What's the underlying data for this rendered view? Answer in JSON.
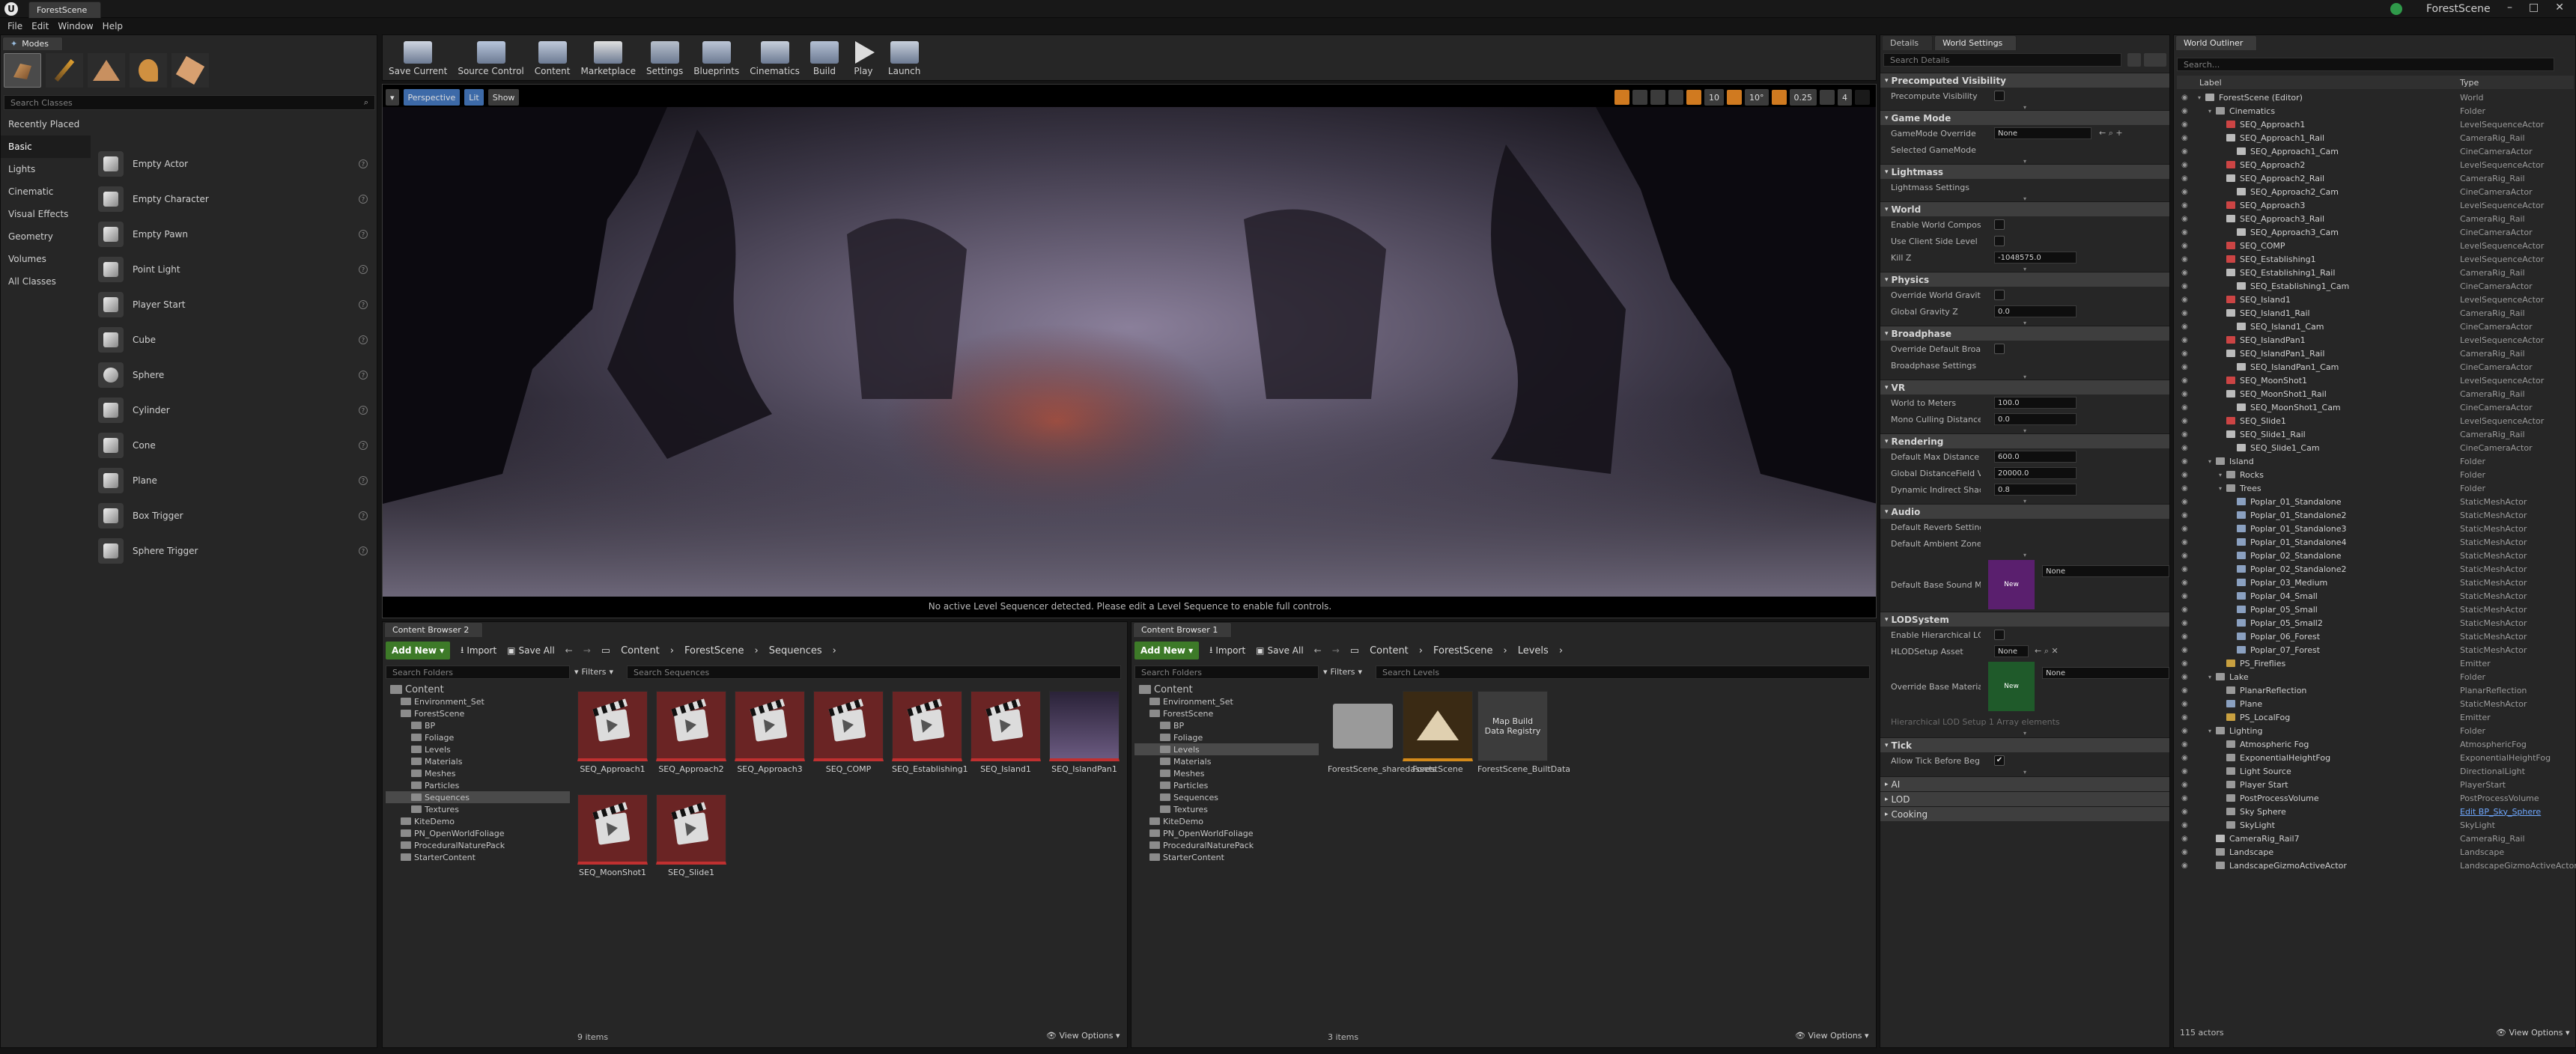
{
  "window": {
    "doc_tab": "ForestScene",
    "project_name": "ForestScene"
  },
  "menu": [
    "File",
    "Edit",
    "Window",
    "Help"
  ],
  "modes": {
    "tab": "Modes",
    "search_placeholder": "Search Classes",
    "categories": [
      "Recently Placed",
      "Basic",
      "Lights",
      "Cinematic",
      "Visual Effects",
      "Geometry",
      "Volumes",
      "All Classes"
    ],
    "items": [
      "Empty Actor",
      "Empty Character",
      "Empty Pawn",
      "Point Light",
      "Player Start",
      "Cube",
      "Sphere",
      "Cylinder",
      "Cone",
      "Plane",
      "Box Trigger",
      "Sphere Trigger"
    ]
  },
  "toolbar": {
    "buttons": [
      "Save Current",
      "Source Control",
      "Content",
      "Marketplace",
      "Settings",
      "Blueprints",
      "Cinematics",
      "Build",
      "Play",
      "Launch"
    ]
  },
  "viewport": {
    "perspective": "Perspective",
    "lit": "Lit",
    "show": "Show",
    "grid_snap": "10",
    "rot_snap": "10°",
    "scale_snap": "0.25",
    "cam_speed": "4",
    "message": "No active Level Sequencer detected. Please edit a Level Sequence to enable full controls."
  },
  "content_browser_2": {
    "tab": "Content Browser 2",
    "add_new": "Add New",
    "import": "Import",
    "save_all": "Save All",
    "breadcrumb": [
      "Content",
      "ForestScene",
      "Sequences"
    ],
    "search_folders": "Search Folders",
    "filters": "Filters",
    "search_assets": "Search Sequences",
    "tree": [
      {
        "label": "Content",
        "depth": 0
      },
      {
        "label": "Environment_Set",
        "depth": 1
      },
      {
        "label": "ForestScene",
        "depth": 1
      },
      {
        "label": "BP",
        "depth": 2
      },
      {
        "label": "Foliage",
        "depth": 2
      },
      {
        "label": "Levels",
        "depth": 2
      },
      {
        "label": "Materials",
        "depth": 2
      },
      {
        "label": "Meshes",
        "depth": 2
      },
      {
        "label": "Particles",
        "depth": 2
      },
      {
        "label": "Sequences",
        "depth": 2
      },
      {
        "label": "Textures",
        "depth": 2
      },
      {
        "label": "KiteDemo",
        "depth": 1
      },
      {
        "label": "PN_OpenWorldFoliage",
        "depth": 1
      },
      {
        "label": "ProceduralNaturePack",
        "depth": 1
      },
      {
        "label": "StarterContent",
        "depth": 1
      }
    ],
    "assets": [
      "SEQ_Approach1",
      "SEQ_Approach2",
      "SEQ_Approach3",
      "SEQ_COMP",
      "SEQ_Establishing1",
      "SEQ_Island1",
      "SEQ_IslandPan1",
      "SEQ_MoonShot1",
      "SEQ_Slide1"
    ],
    "count": "9 items",
    "view_options": "View Options"
  },
  "content_browser_1": {
    "tab": "Content Browser 1",
    "add_new": "Add New",
    "import": "Import",
    "save_all": "Save All",
    "breadcrumb": [
      "Content",
      "ForestScene",
      "Levels"
    ],
    "search_folders": "Search Folders",
    "filters": "Filters",
    "search_assets": "Search Levels",
    "assets": [
      "ForestScene_sharedassets",
      "ForestScene",
      "ForestScene_BuiltData"
    ],
    "map_build_label": "Map Build Data Registry",
    "count": "3 items",
    "view_options": "View Options"
  },
  "details": {
    "tab": "Details",
    "tab2": "World Settings",
    "search_placeholder": "Search Details",
    "sections": [
      {
        "title": "Precomputed Visibility",
        "rows": [
          {
            "label": "Precompute Visibility",
            "type": "check",
            "value": ""
          }
        ]
      },
      {
        "title": "Game Mode",
        "rows": [
          {
            "label": "GameMode Override",
            "type": "combo",
            "value": "None"
          },
          {
            "label": "Selected GameMode",
            "type": "none",
            "value": ""
          }
        ]
      },
      {
        "title": "Lightmass",
        "rows": [
          {
            "label": "Lightmass Settings",
            "type": "none",
            "value": ""
          }
        ]
      },
      {
        "title": "World",
        "rows": [
          {
            "label": "Enable World Composi",
            "type": "check",
            "value": ""
          },
          {
            "label": "Use Client Side Level S",
            "type": "check",
            "value": ""
          },
          {
            "label": "Kill Z",
            "type": "num",
            "value": "-1048575.0"
          }
        ]
      },
      {
        "title": "Physics",
        "rows": [
          {
            "label": "Override World Gravity",
            "type": "check",
            "value": ""
          },
          {
            "label": "Global Gravity Z",
            "type": "num",
            "value": "0.0"
          }
        ]
      },
      {
        "title": "Broadphase",
        "rows": [
          {
            "label": "Override Default Broa",
            "type": "check",
            "value": ""
          },
          {
            "label": "Broadphase Settings",
            "type": "none",
            "value": ""
          }
        ]
      },
      {
        "title": "VR",
        "rows": [
          {
            "label": "World to Meters",
            "type": "num",
            "value": "100.0"
          },
          {
            "label": "Mono Culling Distance",
            "type": "num",
            "value": "0.0"
          }
        ]
      },
      {
        "title": "Rendering",
        "rows": [
          {
            "label": "Default Max Distance",
            "type": "num",
            "value": "600.0"
          },
          {
            "label": "Global DistanceField V",
            "type": "num",
            "value": "20000.0"
          },
          {
            "label": "Dynamic Indirect Shad",
            "type": "num",
            "value": "0.8"
          }
        ]
      },
      {
        "title": "Audio",
        "rows": [
          {
            "label": "Default Reverb Setting",
            "type": "none",
            "value": ""
          },
          {
            "label": "Default Ambient Zone",
            "type": "none",
            "value": ""
          }
        ]
      }
    ],
    "sound_mix_label": "Default Base Sound M",
    "sound_mix_value": "None",
    "thumb_new": "New",
    "lod_title": "LODSystem",
    "lod_rows": [
      "Enable Hierarchical LC",
      "HLODSetup Asset",
      "Override Base Materia"
    ],
    "hlod_value": "None",
    "override_mat_value": "None",
    "hlod_elements": "Hierarchical LOD Setup  1 Array elements",
    "tick_title": "Tick",
    "tick_row": "Allow Tick Before Begi",
    "collapsed": [
      "AI",
      "LOD",
      "Cooking"
    ]
  },
  "outliner": {
    "tab": "World Outliner",
    "search_placeholder": "Search...",
    "col_label": "Label",
    "col_type": "Type",
    "rows": [
      {
        "l": "ForestScene (Editor)",
        "t": "World",
        "d": 0
      },
      {
        "l": "Cinematics",
        "t": "Folder",
        "d": 1
      },
      {
        "l": "SEQ_Approach1",
        "t": "LevelSequenceActor",
        "d": 2
      },
      {
        "l": "SEQ_Approach1_Rail",
        "t": "CameraRig_Rail",
        "d": 2
      },
      {
        "l": "SEQ_Approach1_Cam",
        "t": "CineCameraActor",
        "d": 3
      },
      {
        "l": "SEQ_Approach2",
        "t": "LevelSequenceActor",
        "d": 2
      },
      {
        "l": "SEQ_Approach2_Rail",
        "t": "CameraRig_Rail",
        "d": 2
      },
      {
        "l": "SEQ_Approach2_Cam",
        "t": "CineCameraActor",
        "d": 3
      },
      {
        "l": "SEQ_Approach3",
        "t": "LevelSequenceActor",
        "d": 2
      },
      {
        "l": "SEQ_Approach3_Rail",
        "t": "CameraRig_Rail",
        "d": 2
      },
      {
        "l": "SEQ_Approach3_Cam",
        "t": "CineCameraActor",
        "d": 3
      },
      {
        "l": "SEQ_COMP",
        "t": "LevelSequenceActor",
        "d": 2
      },
      {
        "l": "SEQ_Establishing1",
        "t": "LevelSequenceActor",
        "d": 2
      },
      {
        "l": "SEQ_Establishing1_Rail",
        "t": "CameraRig_Rail",
        "d": 2
      },
      {
        "l": "SEQ_Establishing1_Cam",
        "t": "CineCameraActor",
        "d": 3
      },
      {
        "l": "SEQ_Island1",
        "t": "LevelSequenceActor",
        "d": 2
      },
      {
        "l": "SEQ_Island1_Rail",
        "t": "CameraRig_Rail",
        "d": 2
      },
      {
        "l": "SEQ_Island1_Cam",
        "t": "CineCameraActor",
        "d": 3
      },
      {
        "l": "SEQ_IslandPan1",
        "t": "LevelSequenceActor",
        "d": 2
      },
      {
        "l": "SEQ_IslandPan1_Rail",
        "t": "CameraRig_Rail",
        "d": 2
      },
      {
        "l": "SEQ_IslandPan1_Cam",
        "t": "CineCameraActor",
        "d": 3
      },
      {
        "l": "SEQ_MoonShot1",
        "t": "LevelSequenceActor",
        "d": 2
      },
      {
        "l": "SEQ_MoonShot1_Rail",
        "t": "CameraRig_Rail",
        "d": 2
      },
      {
        "l": "SEQ_MoonShot1_Cam",
        "t": "CineCameraActor",
        "d": 3
      },
      {
        "l": "SEQ_Slide1",
        "t": "LevelSequenceActor",
        "d": 2
      },
      {
        "l": "SEQ_Slide1_Rail",
        "t": "CameraRig_Rail",
        "d": 2
      },
      {
        "l": "SEQ_Slide1_Cam",
        "t": "CineCameraActor",
        "d": 3
      },
      {
        "l": "Island",
        "t": "Folder",
        "d": 1
      },
      {
        "l": "Rocks",
        "t": "Folder",
        "d": 2
      },
      {
        "l": "Trees",
        "t": "Folder",
        "d": 2
      },
      {
        "l": "Poplar_01_Standalone",
        "t": "StaticMeshActor",
        "d": 3
      },
      {
        "l": "Poplar_01_Standalone2",
        "t": "StaticMeshActor",
        "d": 3
      },
      {
        "l": "Poplar_01_Standalone3",
        "t": "StaticMeshActor",
        "d": 3
      },
      {
        "l": "Poplar_01_Standalone4",
        "t": "StaticMeshActor",
        "d": 3
      },
      {
        "l": "Poplar_02_Standalone",
        "t": "StaticMeshActor",
        "d": 3
      },
      {
        "l": "Poplar_02_Standalone2",
        "t": "StaticMeshActor",
        "d": 3
      },
      {
        "l": "Poplar_03_Medium",
        "t": "StaticMeshActor",
        "d": 3
      },
      {
        "l": "Poplar_04_Small",
        "t": "StaticMeshActor",
        "d": 3
      },
      {
        "l": "Poplar_05_Small",
        "t": "StaticMeshActor",
        "d": 3
      },
      {
        "l": "Poplar_05_Small2",
        "t": "StaticMeshActor",
        "d": 3
      },
      {
        "l": "Poplar_06_Forest",
        "t": "StaticMeshActor",
        "d": 3
      },
      {
        "l": "Poplar_07_Forest",
        "t": "StaticMeshActor",
        "d": 3
      },
      {
        "l": "PS_Fireflies",
        "t": "Emitter",
        "d": 2
      },
      {
        "l": "Lake",
        "t": "Folder",
        "d": 1
      },
      {
        "l": "PlanarReflection",
        "t": "PlanarReflection",
        "d": 2
      },
      {
        "l": "Plane",
        "t": "StaticMeshActor",
        "d": 2
      },
      {
        "l": "PS_LocalFog",
        "t": "Emitter",
        "d": 2
      },
      {
        "l": "Lighting",
        "t": "Folder",
        "d": 1
      },
      {
        "l": "Atmospheric Fog",
        "t": "AtmosphericFog",
        "d": 2
      },
      {
        "l": "ExponentialHeightFog",
        "t": "ExponentialHeightFog",
        "d": 2
      },
      {
        "l": "Light Source",
        "t": "DirectionalLight",
        "d": 2
      },
      {
        "l": "Player Start",
        "t": "PlayerStart",
        "d": 2
      },
      {
        "l": "PostProcessVolume",
        "t": "PostProcessVolume",
        "d": 2
      },
      {
        "l": "Sky Sphere",
        "t": "Edit BP_Sky_Sphere",
        "d": 2
      },
      {
        "l": "SkyLight",
        "t": "SkyLight",
        "d": 2
      },
      {
        "l": "CameraRig_Rail7",
        "t": "CameraRig_Rail",
        "d": 1
      },
      {
        "l": "Landscape",
        "t": "Landscape",
        "d": 1
      },
      {
        "l": "LandscapeGizmoActiveActor",
        "t": "LandscapeGizmoActiveActor",
        "d": 1
      }
    ],
    "count": "115 actors",
    "view_options": "View Options"
  },
  "colors": {
    "accent": "#3d7a28",
    "link": "#6fa8ff",
    "seq_thumb": "#6a2424",
    "level_thumb": "#b07a18",
    "mat_thumb": "#5a1f6e"
  }
}
